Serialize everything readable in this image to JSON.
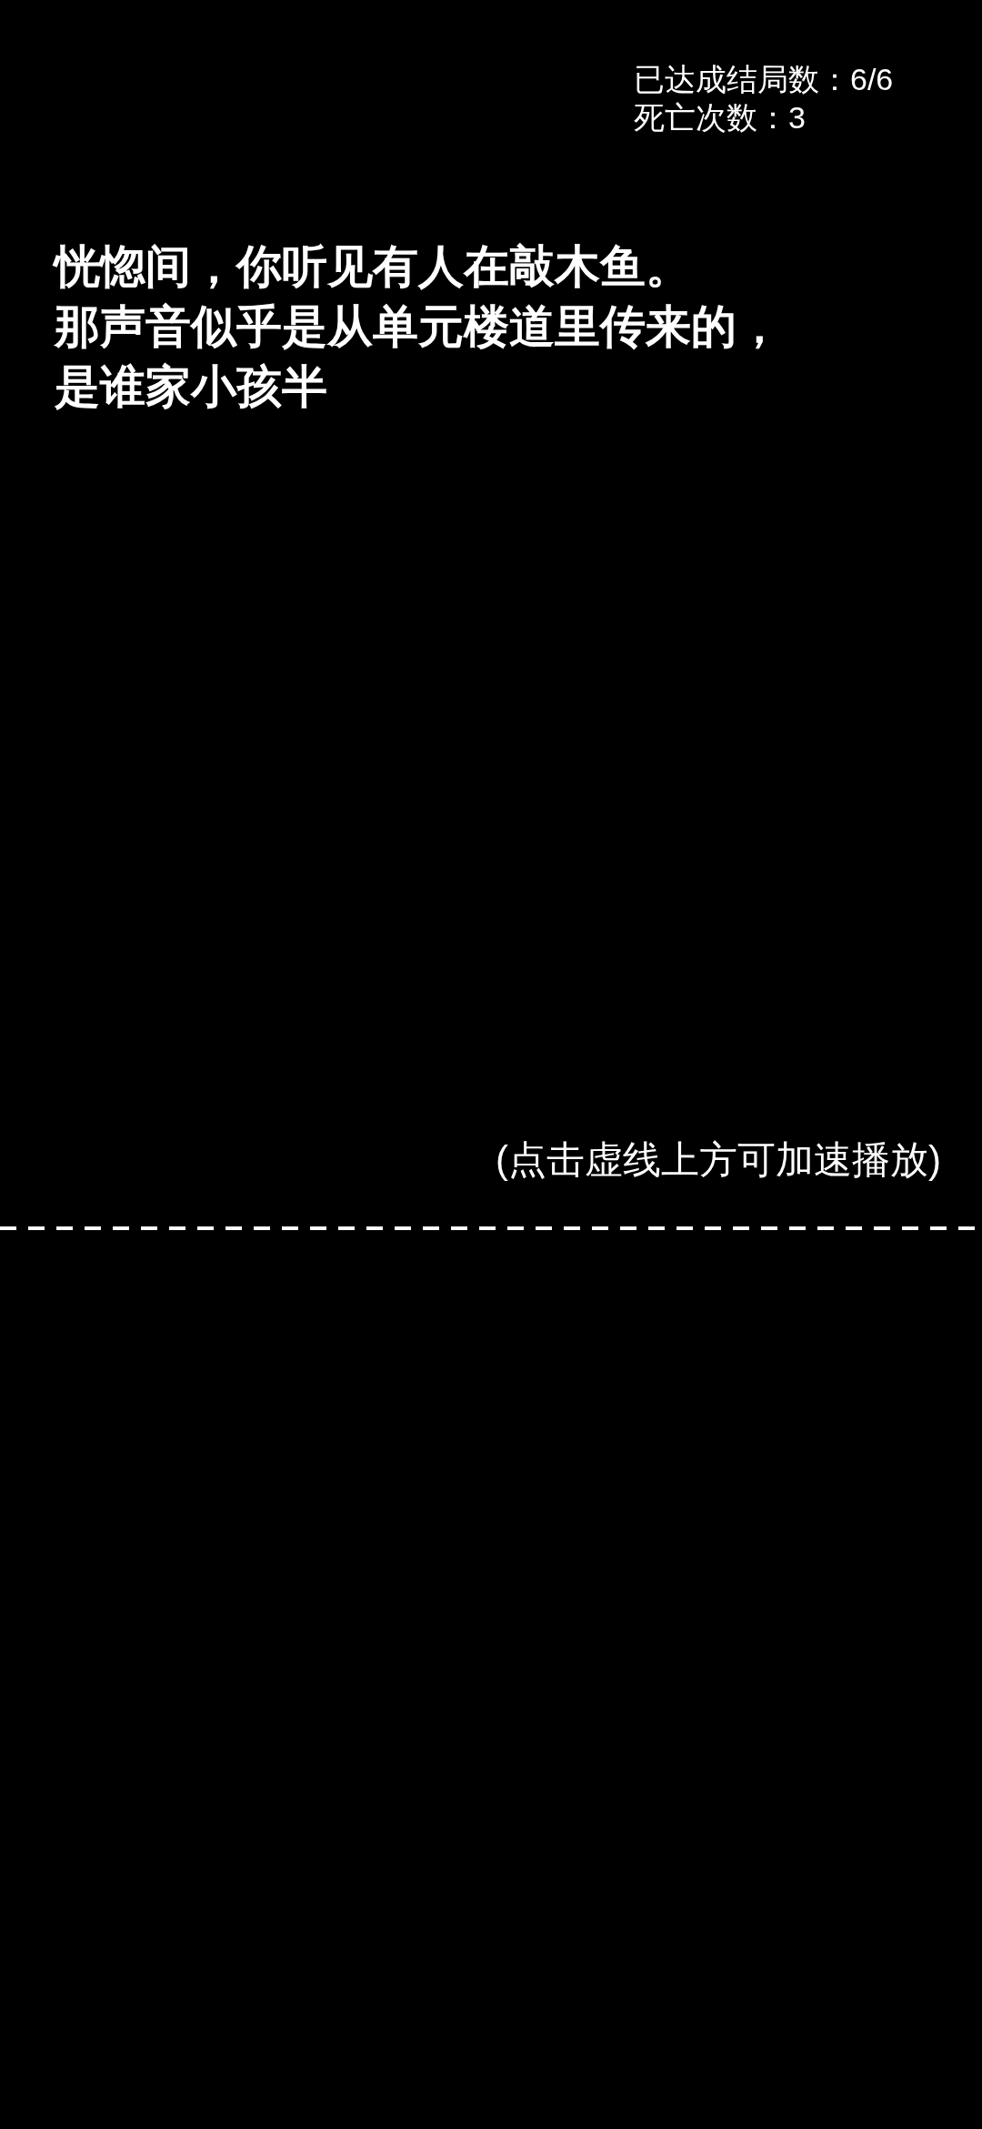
{
  "stats": [
    {
      "label": "已达成结局数：",
      "value": "6/6"
    },
    {
      "label": "死亡次数：",
      "value": "3"
    }
  ],
  "story": {
    "lines": [
      "恍惚间，你听见有人在敲木鱼。",
      "那声音似乎是从单元楼道里传来的，",
      "是谁家小孩半"
    ]
  },
  "hint": "(点击虚线上方可加速播放)"
}
